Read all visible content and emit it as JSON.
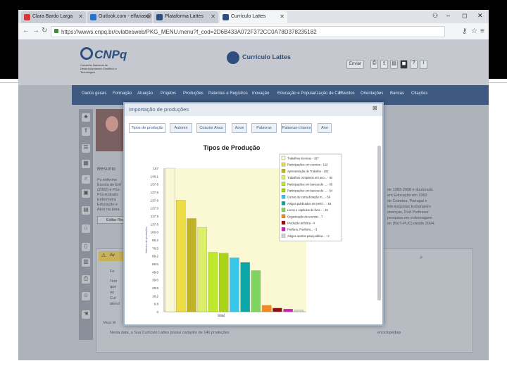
{
  "browser": {
    "tabs": [
      {
        "label": "Clara Bardo Larga",
        "active": false,
        "color": "#d23a3a"
      },
      {
        "label": "Outlook.com - elfarias@",
        "active": false,
        "color": "#2a72c8"
      },
      {
        "label": "Plataforma Lattes",
        "active": false,
        "color": "#2e4f7e"
      },
      {
        "label": "Currículo Lattes",
        "active": true,
        "color": "#2e4f7e"
      }
    ],
    "window_controls": [
      "‒",
      "◻",
      "✕"
    ],
    "url": "https://wwws.cnpq.br/cvlattesweb/PKG_MENU.menu?f_cod=2D6B433A072F372CC0A78D378235182"
  },
  "site": {
    "logo_text": "CNPq",
    "logo_sub": "Conselho Nacional de Desenvolvimento Científico e Tecnológico",
    "lattes_label": "Currículo Lattes",
    "header_button": "Enviar",
    "nav": [
      "Dados gerais",
      "Formação",
      "Atuação",
      "Projetos",
      "Produções",
      "Patentes e Registros",
      "Inovação",
      "Educação e Popularização de C&T",
      "Eventos",
      "Orientações",
      "Bancas",
      "Citações"
    ]
  },
  "background": {
    "resumo_label": "Resumo",
    "resumo_lines": [
      "Fo enferme",
      "Escola de Enf",
      "(2002) e Pós-",
      "Pós-Estrade",
      "Enfermeira",
      "Educação e",
      "Atua na área"
    ],
    "edit_button": "Editar Resu",
    "alert_label": "Av",
    "panel_lines": [
      "Fe",
      "Tem",
      "que",
      "no",
      "Cur",
      "atend"
    ],
    "bottom_line_1": "Voce tê",
    "bottom_line_2": "Nesta data, a Sua Curriculo Lattes possui cadastro de 140 produções",
    "right_lines": [
      "de 1983-2008 e doutorado",
      "em Educação em 1993",
      "de Coimbra, Portugal e",
      "lide Esquisas Estrangeiro",
      "doenças, Prof Professor",
      "pesquisa em enfermagem",
      "do (NUT-PUC) desde 2004."
    ],
    "right_bottom": "enciclopédias"
  },
  "dialog": {
    "title": "Importação de produções",
    "tabs": [
      "Tipos de produção",
      "Autores",
      "Coautor Anos",
      "Anos",
      "Palavras",
      "Palavras-chaves",
      "Ano"
    ],
    "active_tab": 0
  },
  "chart_data": {
    "type": "bar",
    "title": "Tipos de Produção",
    "xlabel": "total",
    "ylabel": "Número de produções",
    "ylim": [
      0,
      157
    ],
    "yticks": [
      "157",
      "146.1",
      "137.8",
      "137.6",
      "137.6",
      "127.0",
      "117.8",
      "137.6",
      "100.0",
      "85.2",
      "78.5",
      "68.2",
      "56.6",
      "49.9",
      "39.6",
      "28.9",
      "18.2",
      "9.8",
      "0"
    ],
    "categories": [
      "Trabalhos técnicos",
      "Participações em eventos",
      "Apresentação de Trabalho",
      "Trabalhos completos em anais",
      "Participações em bancas",
      "Participações em bancas",
      "Cursos de curta duração",
      "Artigos publicados",
      "Livros e capítulos de livros",
      "Organização de eventos",
      "Produção artística",
      "Prefácio, Posfácio",
      "Artigos aceitos para publicação"
    ],
    "legend": [
      "Trabalhos técnicos - 157",
      "Participações em eventos - 122",
      "Apresentação de Trabalho - 102",
      "Trabalhos completos em ano... - 92",
      "Participações em bancas de ... - 65",
      "Participações em bancas de ... - 64",
      "Cursos de curta duração m... - 59",
      "Artigos publicados em perió... - 54",
      "Livros e capítulos de livro... - 45",
      "Organização de eventos - 7",
      "Produção artística - 4",
      "Prefácio, Posfácio... - 3",
      "Artigos aceitos para publica... - 2"
    ],
    "values": [
      157,
      122,
      102,
      92,
      65,
      64,
      59,
      54,
      45,
      7,
      4,
      3,
      2
    ],
    "colors": [
      "#fbf8d6",
      "#eedc43",
      "#c2b225",
      "#dcef6a",
      "#bde82b",
      "#aad417",
      "#38c7e8",
      "#0da6a6",
      "#7ed45e",
      "#f08a24",
      "#8b1010",
      "#d11fb8",
      "#d4d4d4"
    ],
    "plot_area_color": "#fbf9d4"
  }
}
